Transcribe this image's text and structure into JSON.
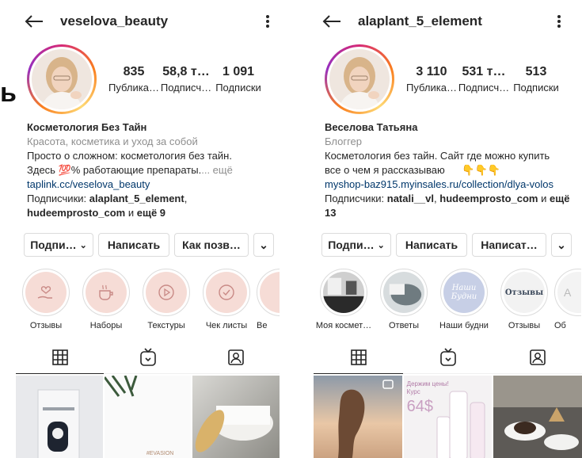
{
  "fragment": "ы",
  "left": {
    "username": "veselova_beauty",
    "stats": [
      {
        "num": "835",
        "label": "Публика…"
      },
      {
        "num": "58,8 т…",
        "label": "Подписч…"
      },
      {
        "num": "1 091",
        "label": "Подписки"
      }
    ],
    "bio": {
      "name": "Косметология Без Тайн",
      "category": "Красота, косметика и уход за собой",
      "line1": "Просто о сложном: косметология без тайн.",
      "line2_prefix": "Здесь ",
      "line2_emoji": "💯",
      "line2_text": "% работающие препараты.",
      "more": "... ещё",
      "link": "taplink.cc/veselova_beauty",
      "followers_prefix": "Подписчики: ",
      "follower1": "alaplant_5_element",
      "follower2": "hudeemprosto_com",
      "and": " и ",
      "more_count": "ещё 9"
    },
    "buttons": {
      "follow": "Подпи…",
      "message": "Написать",
      "contact": "Как позв…"
    },
    "highlights": [
      "Отзывы",
      "Наборы",
      "Текстуры",
      "Чек листы",
      "Ве"
    ],
    "grid_labels": {
      "cell2": "#EVASION"
    }
  },
  "right": {
    "username": "alaplant_5_element",
    "stats": [
      {
        "num": "3 110",
        "label": "Публика…"
      },
      {
        "num": "531 т…",
        "label": "Подписч…"
      },
      {
        "num": "513",
        "label": "Подписки"
      }
    ],
    "bio": {
      "name": "Веселова Татьяна",
      "category": "Блоггер",
      "line1": "Косметология без тайн. Сайт где можно купить",
      "line2": "все о чем я рассказываю",
      "hands": "👇👇👇",
      "link": "myshop-baz915.myinsales.ru/collection/dlya-volos",
      "followers_prefix": "Подписчики: ",
      "follower1": "natali__vl",
      "follower2": "hudeemprosto_com",
      "and": " и ",
      "more_count": "ещё 13"
    },
    "buttons": {
      "follow": "Подпи…",
      "message": "Написать",
      "contact": "Написат…"
    },
    "highlights": [
      "Моя космет…",
      "Ответы",
      "Наши будни",
      "Отзывы",
      "Об"
    ],
    "highlight_text": {
      "h3": "Наши Будни",
      "h4": "Отзывы",
      "h5": "А"
    },
    "grid_labels": {
      "promo1": "Держим цены!",
      "promo2": "Курс",
      "price": "64$"
    }
  },
  "colors": {
    "link": "#00376b",
    "muted": "#8e8e8e",
    "highlight_bg": "#f6dcd6"
  }
}
